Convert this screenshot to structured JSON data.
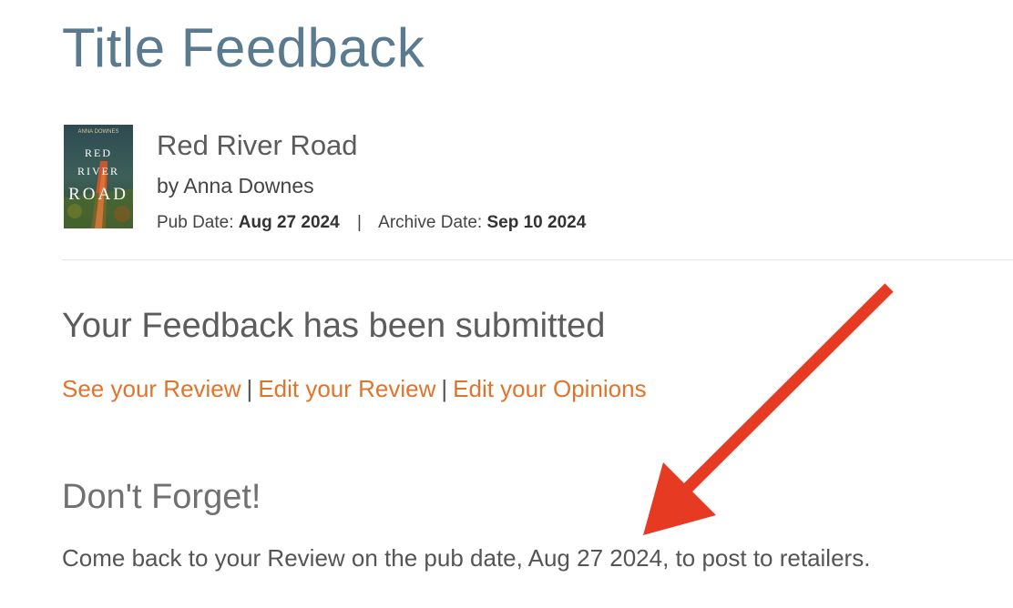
{
  "page": {
    "title": "Title Feedback"
  },
  "book": {
    "title": "Red River Road",
    "author": "by Anna Downes",
    "pub_date_label": "Pub Date:",
    "pub_date": "Aug 27 2024",
    "separator": "|",
    "archive_date_label": "Archive Date:",
    "archive_date": "Sep 10 2024",
    "cover_text": {
      "author": "ANNA DOWNES",
      "line1": "RED",
      "line2": "RIVER",
      "line3": "ROAD"
    }
  },
  "feedback": {
    "heading": "Your Feedback has been submitted",
    "links": {
      "see_review": "See your Review",
      "edit_review": "Edit your Review",
      "edit_opinions": "Edit your Opinions",
      "pipe": "|"
    }
  },
  "reminder": {
    "heading": "Don't Forget!",
    "text": "Come back to your Review on the pub date, Aug 27 2024, to post to retailers."
  },
  "colors": {
    "title": "#5a7a90",
    "link": "#e2732b",
    "arrow": "#e63a22"
  },
  "icons": {
    "annotation_arrow": "red-arrow-icon"
  }
}
